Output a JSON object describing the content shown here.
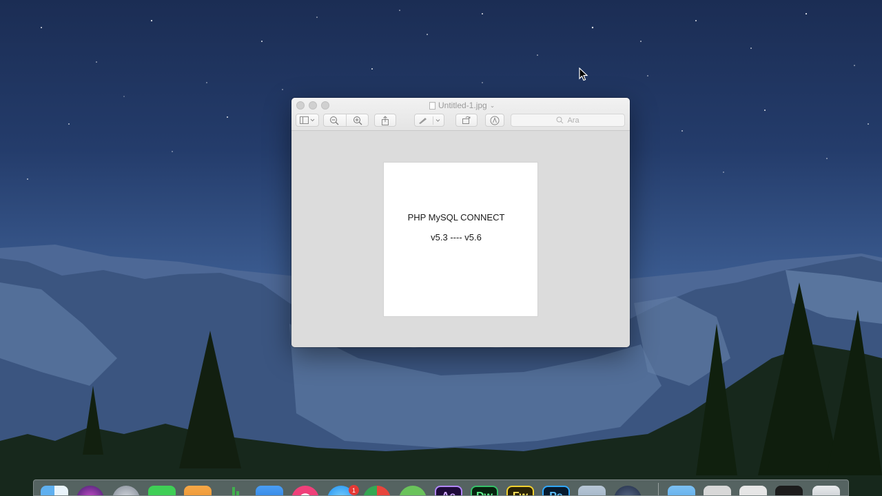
{
  "window": {
    "title": "Untitled-1.jpg",
    "search_placeholder": "Ara"
  },
  "image_content": {
    "line1": "PHP MySQL CONNECT",
    "line2": "v5.3 ---- v5.6"
  },
  "dock": {
    "badge_count": "1",
    "apps": [
      "finder-icon",
      "siri-icon",
      "launchpad-icon",
      "facetime-icon",
      "pages-icon",
      "numbers-icon",
      "keynote-icon",
      "itunes-icon",
      "appstore-icon",
      "chrome-icon",
      "evernote-icon",
      "after-effects-icon",
      "dreamweaver-icon",
      "fireworks-icon",
      "photoshop-icon",
      "preview-icon",
      "quicktime-icon",
      "downloads-folder-icon",
      "documents-icon",
      "screenshot-icon",
      "terminal-icon",
      "trash-icon"
    ],
    "app_labels": [
      "Ae",
      "Dw",
      "Fw",
      "Ps"
    ]
  }
}
